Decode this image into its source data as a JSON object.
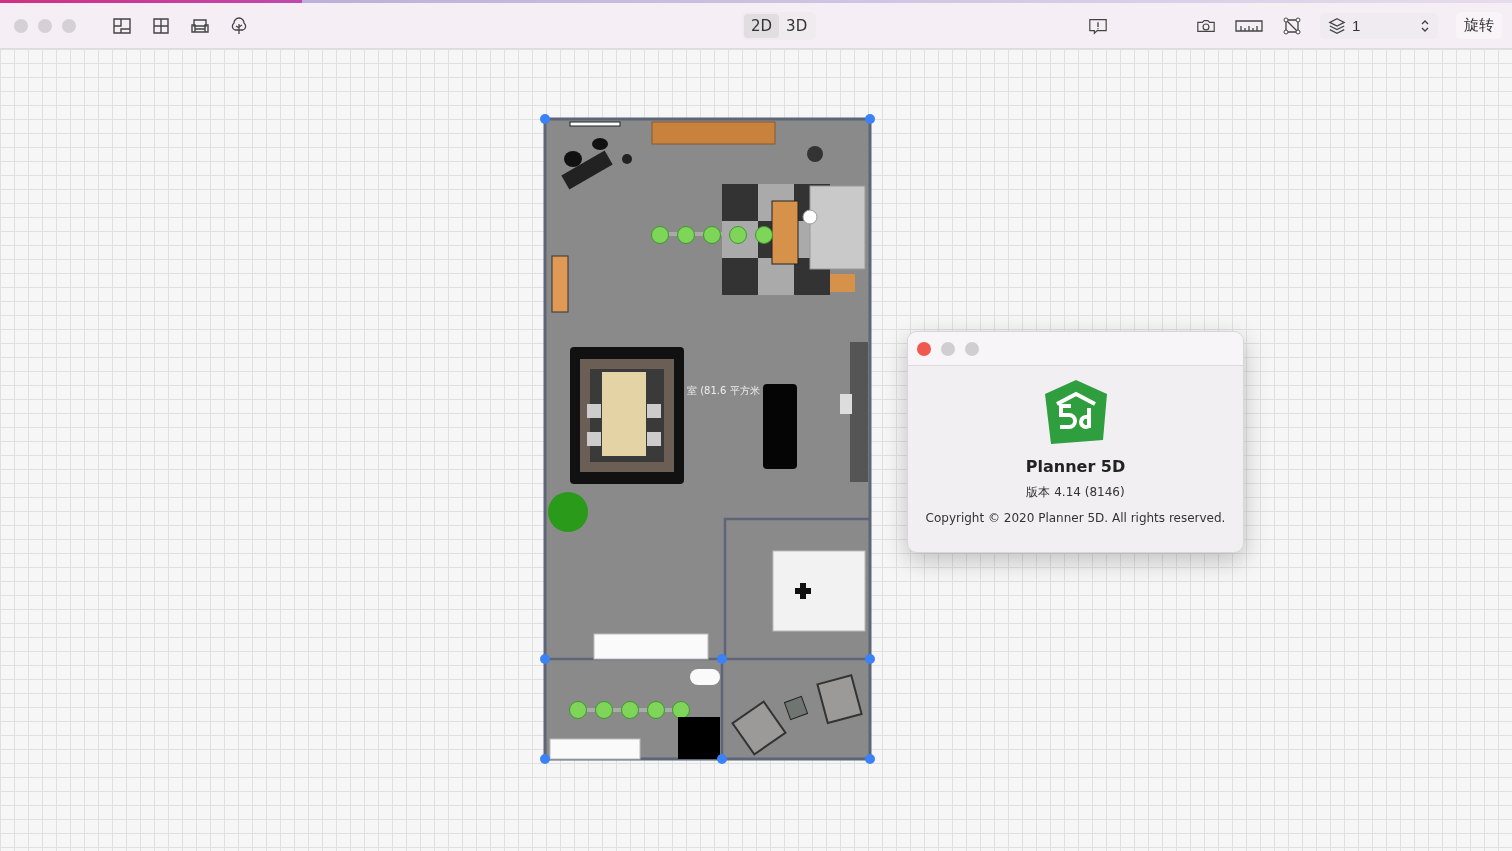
{
  "toolbar": {
    "view_modes": [
      {
        "label": "2D",
        "selected": true
      },
      {
        "label": "3D",
        "selected": false
      }
    ],
    "layer_select": {
      "value": "1"
    },
    "rotate_button": "旋转"
  },
  "plan": {
    "room_label": "室 (81.6 平方米"
  },
  "about_dialog": {
    "title": "Planner 5D",
    "version": "版本 4.14 (8146)",
    "copyright": "Copyright © 2020 Planner 5D. All rights reserved."
  }
}
